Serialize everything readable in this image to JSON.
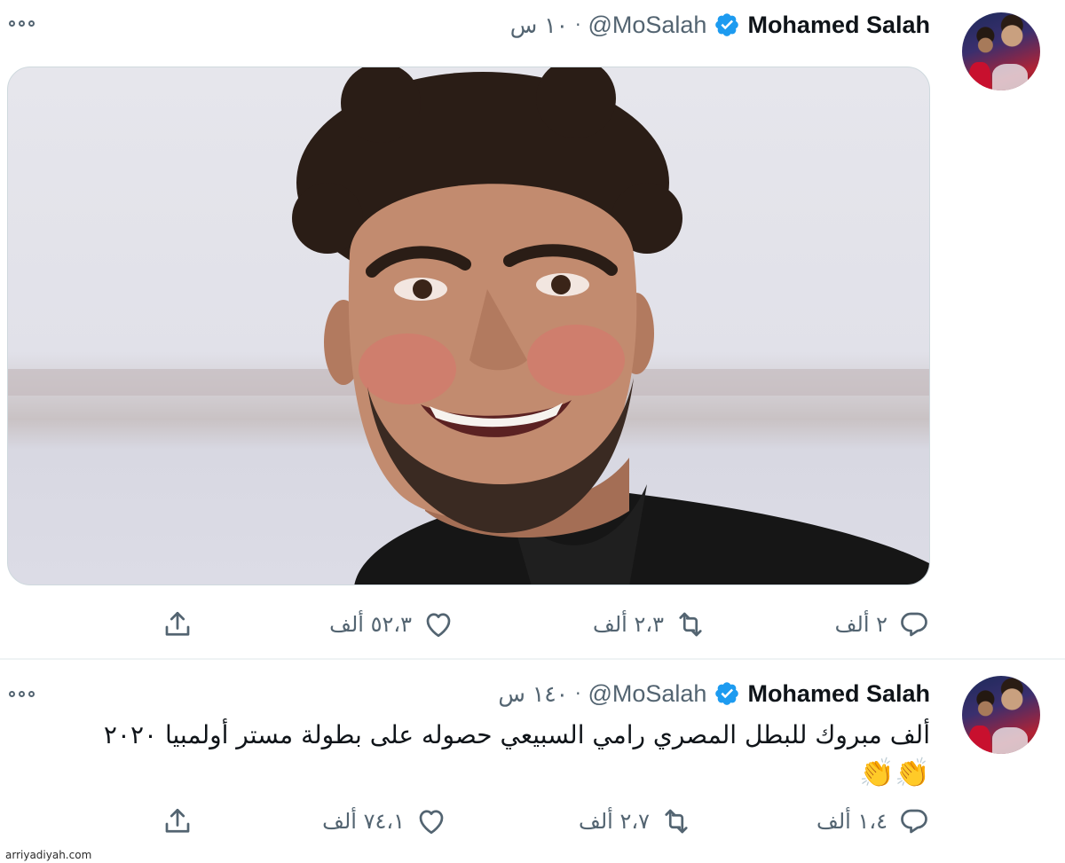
{
  "tweets": [
    {
      "author": {
        "name": "Mohamed Salah",
        "handle": "@MoSalah"
      },
      "separator": "·",
      "time": "١٠ س",
      "text": "",
      "emojis": "",
      "metrics": {
        "replies": "٢ ألف",
        "retweets": "٢،٣ ألف",
        "likes": "٥٢،٣ ألف"
      }
    },
    {
      "author": {
        "name": "Mohamed Salah",
        "handle": "@MoSalah"
      },
      "separator": "·",
      "time": "١٤٠ س",
      "text": "ألف مبروك للبطل المصري رامي السبيعي حصوله على بطولة مستر أولمبيا ٢٠٢٠",
      "emojis": "👏👏",
      "metrics": {
        "replies": "١،٤ ألف",
        "retweets": "٢،٧ ألف",
        "likes": "٧٤،١ ألف"
      }
    }
  ],
  "watermark": "arriyadiyah.com",
  "colors": {
    "verified": "#1d9bf0",
    "secondary_text": "#536471",
    "primary_text": "#0f1419",
    "divider": "#eff3f4"
  },
  "icons": [
    "verified-badge-icon",
    "more-options-icon",
    "reply-icon",
    "retweet-icon",
    "like-icon",
    "share-icon"
  ]
}
